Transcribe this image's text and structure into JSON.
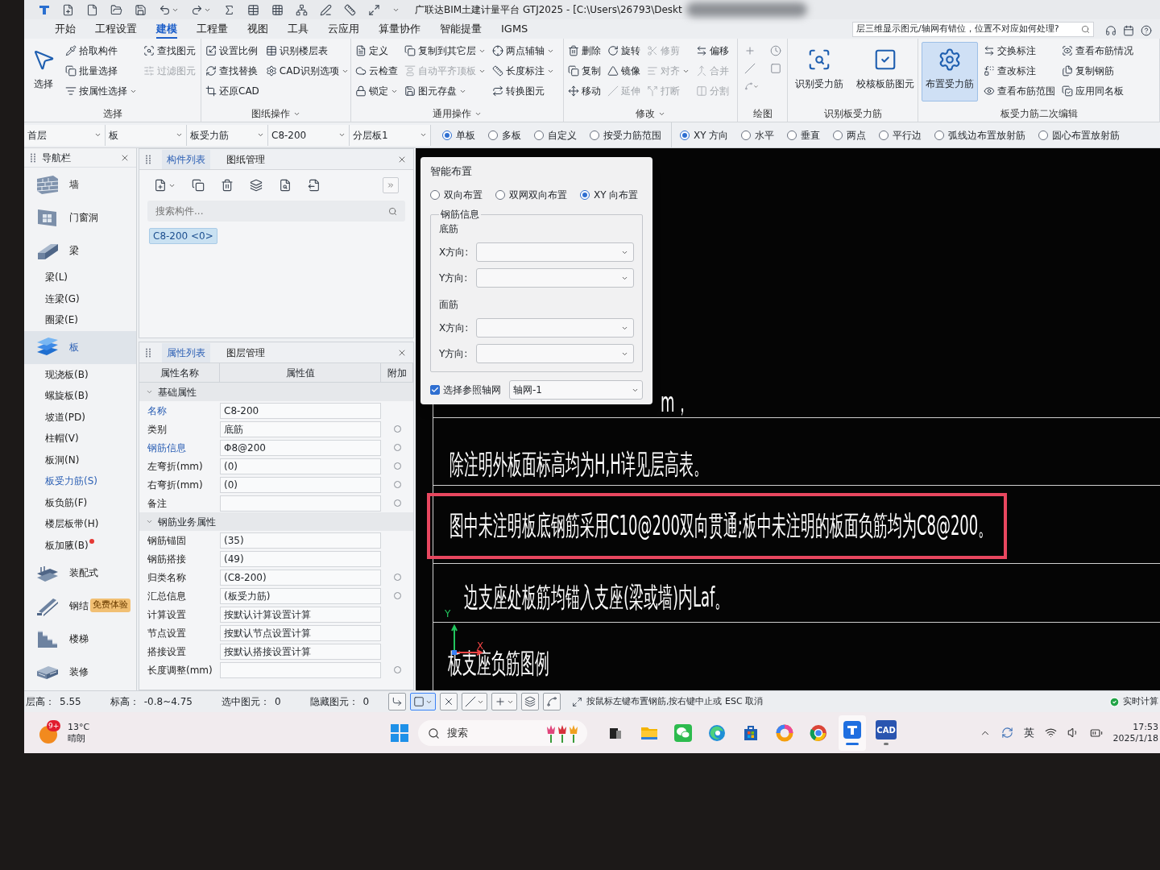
{
  "title_bar": {
    "title": "广联达BIM土建计量平台 GTJ2025 - [C:\\Users\\26793\\Deskt"
  },
  "menu": {
    "tabs": [
      {
        "label": "开始",
        "selected": false
      },
      {
        "label": "工程设置",
        "selected": false
      },
      {
        "label": "建模",
        "selected": true
      },
      {
        "label": "工程量",
        "selected": false
      },
      {
        "label": "视图",
        "selected": false
      },
      {
        "label": "工具",
        "selected": false
      },
      {
        "label": "云应用",
        "selected": false
      },
      {
        "label": "算量协作",
        "selected": false
      },
      {
        "label": "智能提量",
        "selected": false
      },
      {
        "label": "IGMS",
        "selected": false
      }
    ],
    "help_search": {
      "value": "层三维显示图元/轴网有错位，位置不对应如何处理?"
    }
  },
  "ribbon": {
    "groups": [
      {
        "label": "选择",
        "menu": false,
        "kind": "buttons",
        "large": [
          {
            "label": "选择",
            "selected": false
          }
        ],
        "columns": [
          [
            {
              "label": "拾取构件",
              "dropdown": false,
              "disabled": false
            },
            {
              "label": "批量选择",
              "dropdown": false,
              "disabled": false
            },
            {
              "label": "按属性选择",
              "dropdown": true,
              "disabled": false
            }
          ],
          [
            {
              "label": "查找图元",
              "dropdown": false,
              "disabled": false
            },
            {
              "label": "过滤图元",
              "dropdown": false,
              "disabled": true
            }
          ]
        ]
      },
      {
        "label": "图纸操作",
        "menu": true,
        "kind": "buttons",
        "columns": [
          [
            {
              "label": "设置比例",
              "dropdown": false,
              "disabled": false
            },
            {
              "label": "查找替换",
              "dropdown": false,
              "disabled": false
            },
            {
              "label": "还原CAD",
              "dropdown": false,
              "disabled": false
            }
          ],
          [
            {
              "label": "识别楼层表",
              "dropdown": false,
              "disabled": false
            },
            {
              "label": "CAD识别选项",
              "dropdown": true,
              "disabled": false
            }
          ]
        ]
      },
      {
        "label": "通用操作",
        "menu": true,
        "kind": "buttons",
        "columns": [
          [
            {
              "label": "定义",
              "dropdown": false,
              "disabled": false
            },
            {
              "label": "云检查",
              "dropdown": false,
              "disabled": false
            },
            {
              "label": "锁定",
              "dropdown": true,
              "disabled": false
            }
          ],
          [
            {
              "label": "复制到其它层",
              "dropdown": true,
              "disabled": false
            },
            {
              "label": "自动平齐顶板",
              "dropdown": true,
              "disabled": true
            },
            {
              "label": "图元存盘",
              "dropdown": true,
              "disabled": false
            }
          ],
          [
            {
              "label": "两点辅轴",
              "dropdown": true,
              "disabled": false
            },
            {
              "label": "长度标注",
              "dropdown": true,
              "disabled": false
            },
            {
              "label": "转换图元",
              "dropdown": false,
              "disabled": false
            }
          ]
        ]
      },
      {
        "label": "修改",
        "menu": true,
        "kind": "buttons",
        "columns": [
          [
            {
              "label": "删除",
              "dropdown": false,
              "disabled": false
            },
            {
              "label": "复制",
              "dropdown": false,
              "disabled": false
            },
            {
              "label": "移动",
              "dropdown": false,
              "disabled": false
            }
          ],
          [
            {
              "label": "旋转",
              "dropdown": false,
              "disabled": false
            },
            {
              "label": "镜像",
              "dropdown": false,
              "disabled": false
            },
            {
              "label": "延伸",
              "dropdown": false,
              "disabled": true
            }
          ],
          [
            {
              "label": "修剪",
              "dropdown": false,
              "disabled": true
            },
            {
              "label": "对齐",
              "dropdown": true,
              "disabled": true
            },
            {
              "label": "打断",
              "dropdown": false,
              "disabled": true
            }
          ],
          [
            {
              "label": "偏移",
              "dropdown": false,
              "disabled": false
            },
            {
              "label": "合并",
              "dropdown": false,
              "disabled": true
            },
            {
              "label": "分割",
              "dropdown": false,
              "disabled": true
            }
          ]
        ]
      },
      {
        "label": "绘图",
        "menu": false,
        "kind": "drawing"
      },
      {
        "label": "识别板受力筋",
        "menu": false,
        "kind": "buttons",
        "large": [
          {
            "label": "识别受力筋",
            "selected": false
          },
          {
            "label": "校核板筋图元",
            "selected": false
          }
        ]
      },
      {
        "label": "板受力筋二次编辑",
        "menu": false,
        "kind": "buttons",
        "large": [
          {
            "label": "布置受力筋",
            "selected": true
          }
        ],
        "columns": [
          [
            {
              "label": "交换标注",
              "dropdown": false,
              "disabled": false
            },
            {
              "label": "查改标注",
              "dropdown": false,
              "disabled": false
            },
            {
              "label": "查看布筋范围",
              "dropdown": false,
              "disabled": false
            }
          ],
          [
            {
              "label": "查看布筋情况",
              "dropdown": false,
              "disabled": false
            },
            {
              "label": "复制钢筋",
              "dropdown": false,
              "disabled": false
            },
            {
              "label": "应用同名板",
              "dropdown": false,
              "disabled": false
            }
          ]
        ]
      }
    ]
  },
  "property_bar": {
    "dropdowns": [
      {
        "value": "首层"
      },
      {
        "value": "板"
      },
      {
        "value": "板受力筋"
      },
      {
        "value": "C8-200"
      },
      {
        "value": "分层板1"
      }
    ],
    "scope_options": [
      {
        "label": "单板",
        "selected": true
      },
      {
        "label": "多板",
        "selected": false
      },
      {
        "label": "自定义",
        "selected": false
      },
      {
        "label": "按受力筋范围",
        "selected": false
      }
    ],
    "direction_options": [
      {
        "label": "XY 方向",
        "selected": true
      },
      {
        "label": "水平",
        "selected": false
      },
      {
        "label": "垂直",
        "selected": false
      },
      {
        "label": "两点",
        "selected": false
      },
      {
        "label": "平行边",
        "selected": false
      },
      {
        "label": "弧线边布置放射筋",
        "selected": false
      },
      {
        "label": "圆心布置放射筋",
        "selected": false
      }
    ]
  },
  "navigation": {
    "title": "导航栏",
    "items": [
      {
        "kind": "category",
        "label": "墙",
        "selected": false,
        "new": false
      },
      {
        "kind": "category",
        "label": "门窗洞",
        "selected": false,
        "new": false
      },
      {
        "kind": "category",
        "label": "梁",
        "selected": false,
        "new": false
      },
      {
        "kind": "sub",
        "label": "梁(L)",
        "selected": false,
        "new": false
      },
      {
        "kind": "sub",
        "label": "连梁(G)",
        "selected": false,
        "new": false
      },
      {
        "kind": "sub",
        "label": "圈梁(E)",
        "selected": false,
        "new": false
      },
      {
        "kind": "category",
        "label": "板",
        "selected": true,
        "new": false
      },
      {
        "kind": "sub",
        "label": "现浇板(B)",
        "selected": false,
        "new": false
      },
      {
        "kind": "sub",
        "label": "螺旋板(B)",
        "selected": false,
        "new": false
      },
      {
        "kind": "sub",
        "label": "坡道(PD)",
        "selected": false,
        "new": false
      },
      {
        "kind": "sub",
        "label": "柱帽(V)",
        "selected": false,
        "new": false
      },
      {
        "kind": "sub",
        "label": "板洞(N)",
        "selected": false,
        "new": false
      },
      {
        "kind": "sub",
        "label": "板受力筋(S)",
        "selected": true,
        "new": false
      },
      {
        "kind": "sub",
        "label": "板负筋(F)",
        "selected": false,
        "new": false
      },
      {
        "kind": "sub",
        "label": "楼层板带(H)",
        "selected": false,
        "new": false
      },
      {
        "kind": "sub",
        "label": "板加腋(B)",
        "selected": false,
        "new": true
      },
      {
        "kind": "category",
        "label": "装配式",
        "selected": false,
        "new": false
      },
      {
        "kind": "category",
        "label": "钢结",
        "selected": false,
        "new": false,
        "badge": "免费体验"
      },
      {
        "kind": "category",
        "label": "楼梯",
        "selected": false,
        "new": false
      },
      {
        "kind": "category",
        "label": "装修",
        "selected": false,
        "new": false
      }
    ]
  },
  "component_list": {
    "tabs": [
      {
        "label": "构件列表",
        "selected": true
      },
      {
        "label": "图纸管理",
        "selected": false
      }
    ],
    "search": {
      "placeholder": "搜索构件..."
    },
    "items": [
      {
        "label": "C8-200 <0>",
        "selected": true
      }
    ]
  },
  "properties": {
    "tabs": [
      {
        "label": "属性列表",
        "selected": true
      },
      {
        "label": "图层管理",
        "selected": false
      }
    ],
    "columns": [
      "属性名称",
      "属性值",
      "附加"
    ],
    "rows": [
      {
        "kind": "group",
        "label": "基础属性",
        "expanded": true
      },
      {
        "kind": "property",
        "name": "名称",
        "value": "C8-200",
        "emphasized": true,
        "attach_option": false
      },
      {
        "kind": "property",
        "name": "类别",
        "value": "底筋",
        "emphasized": false,
        "attach_option": true
      },
      {
        "kind": "property",
        "name": "钢筋信息",
        "value": "Φ8@200",
        "emphasized": true,
        "attach_option": true
      },
      {
        "kind": "property",
        "name": "左弯折(mm)",
        "value": "(0)",
        "emphasized": false,
        "attach_option": true
      },
      {
        "kind": "property",
        "name": "右弯折(mm)",
        "value": "(0)",
        "emphasized": false,
        "attach_option": true
      },
      {
        "kind": "property",
        "name": "备注",
        "emphasized": false,
        "attach_option": true
      },
      {
        "kind": "group",
        "label": "钢筋业务属性",
        "expanded": true
      },
      {
        "kind": "property",
        "name": "钢筋锚固",
        "value": "(35)",
        "emphasized": false,
        "attach_option": false
      },
      {
        "kind": "property",
        "name": "钢筋搭接",
        "value": "(49)",
        "emphasized": false,
        "attach_option": false
      },
      {
        "kind": "property",
        "name": "归类名称",
        "value": "(C8-200)",
        "emphasized": false,
        "attach_option": true
      },
      {
        "kind": "property",
        "name": "汇总信息",
        "value": "(板受力筋)",
        "emphasized": false,
        "attach_option": true
      },
      {
        "kind": "property",
        "name": "计算设置",
        "value": "按默认计算设置计算",
        "emphasized": false,
        "attach_option": false
      },
      {
        "kind": "property",
        "name": "节点设置",
        "value": "按默认节点设置计算",
        "emphasized": false,
        "attach_option": false
      },
      {
        "kind": "property",
        "name": "搭接设置",
        "value": "按默认搭接设置计算",
        "emphasized": false,
        "attach_option": false
      },
      {
        "kind": "property",
        "name": "长度调整(mm)",
        "emphasized": false,
        "attach_option": true
      }
    ]
  },
  "smart_layout_dialog": {
    "title": "智能布置",
    "modes": [
      {
        "label": "双向布置",
        "selected": false
      },
      {
        "label": "双网双向布置",
        "selected": false
      },
      {
        "label": "XY 向布置",
        "selected": true
      }
    ],
    "rebar_info": {
      "legend": "钢筋信息",
      "sections": [
        {
          "label": "底筋",
          "fields": [
            {
              "label": "X方向:"
            },
            {
              "label": "Y方向:"
            }
          ]
        },
        {
          "label": "面筋",
          "fields": [
            {
              "label": "X方向:"
            },
            {
              "label": "Y方向:"
            }
          ]
        }
      ]
    },
    "reference_grid": {
      "label": "选择参照轴网",
      "checked": true,
      "value": "轴网-1"
    }
  },
  "canvas": {
    "texts": [
      {
        "text": "m，",
        "highlighted": false
      },
      {
        "text": "除注明外板面标高均为H,H详见层高表。",
        "highlighted": false
      },
      {
        "text": "图中未注明板底钢筋采用C10@200双向贯通;板中未注明的板面负筋均为C8@200。",
        "highlighted": true
      },
      {
        "text": "边支座处板筋均锚入支座(梁或墙)内Laf。",
        "highlighted": false
      },
      {
        "text": "板支座负筋图例",
        "highlighted": false
      }
    ],
    "ucs": {
      "x_label": "X",
      "y_label": "Y"
    }
  },
  "status_bar": {
    "info": [
      {
        "label": "层高：",
        "value": "5.55"
      },
      {
        "label": "标高：",
        "value": "-0.8~4.75"
      },
      {
        "label": "选中图元：",
        "value": "0"
      },
      {
        "label": "隐藏图元：",
        "value": "0"
      }
    ],
    "tools": [
      {
        "selected": false,
        "dropdown": false
      },
      {
        "selected": true,
        "dropdown": true
      },
      {
        "selected": false,
        "dropdown": false
      },
      {
        "selected": false,
        "dropdown": true
      },
      {
        "selected": false,
        "dropdown": true
      },
      {
        "selected": false,
        "dropdown": false
      },
      {
        "selected": false,
        "dropdown": false
      }
    ],
    "hint": "按鼠标左键布置钢筋,按右键中止或 ESC 取消",
    "realtime": {
      "label": "实时计算",
      "on": true
    }
  },
  "taskbar": {
    "weather": {
      "badge": "9+",
      "temperature": "13°C",
      "condition": "晴朗"
    },
    "search": {
      "placeholder": "搜索"
    },
    "apps": [
      {
        "open": false,
        "selected": false
      },
      {
        "open": false,
        "selected": false
      },
      {
        "open": false,
        "selected": false
      },
      {
        "open": false,
        "selected": false
      },
      {
        "open": false,
        "selected": false
      },
      {
        "open": false,
        "selected": false
      },
      {
        "open": false,
        "selected": false
      },
      {
        "open": true,
        "selected": true
      },
      {
        "label": "CAD",
        "open": true,
        "selected": false
      }
    ],
    "tray": {
      "input_method": "英",
      "time": "17:53",
      "date": "2025/1/18"
    }
  }
}
